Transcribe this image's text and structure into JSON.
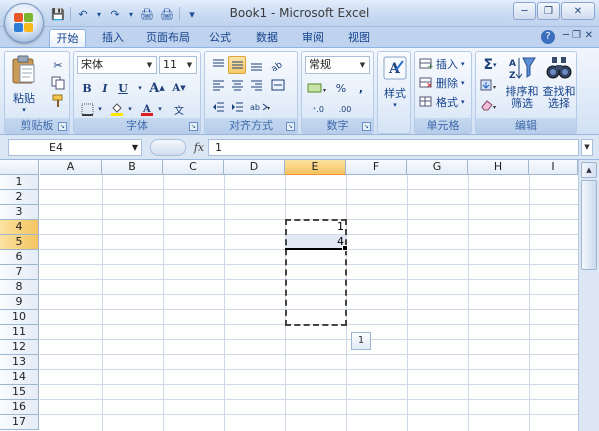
{
  "window": {
    "title": "Book1 - Microsoft Excel",
    "minimize": "─",
    "restore": "❐",
    "close": "✕"
  },
  "quick_access": {
    "save": "💾",
    "undo": "↶",
    "redo": "↷",
    "print_preview": "🖨",
    "customize": "▾"
  },
  "tabs": [
    "开始",
    "插入",
    "页面布局",
    "公式",
    "数据",
    "审阅",
    "视图"
  ],
  "active_tab": "开始",
  "ribbon": {
    "clipboard": {
      "paste_label": "粘贴",
      "group_label": "剪贴板"
    },
    "font": {
      "font_name": "宋体",
      "font_size": "11",
      "bold": "B",
      "italic": "I",
      "underline": "U",
      "grow": "A",
      "shrink": "A",
      "group_label": "字体"
    },
    "alignment": {
      "group_label": "对齐方式"
    },
    "number": {
      "format": "常规",
      "percent": "%",
      "comma": ",",
      "increase_decimal": "⁺.0",
      "decrease_decimal": ".00",
      "group_label": "数字"
    },
    "styles": {
      "label": "样式"
    },
    "cells": {
      "insert": "插入",
      "delete": "删除",
      "format": "格式",
      "group_label": "单元格"
    },
    "editing": {
      "sort_filter_line1": "排序和",
      "sort_filter_line2": "筛选",
      "find_select_line1": "查找和",
      "find_select_line2": "选择",
      "group_label": "编辑"
    }
  },
  "formula_bar": {
    "name_box": "E4",
    "fx": "fx",
    "content": "1"
  },
  "sheet": {
    "columns": [
      "A",
      "B",
      "C",
      "D",
      "E",
      "F",
      "G",
      "H",
      "I"
    ],
    "rows": [
      "1",
      "2",
      "3",
      "4",
      "5",
      "6",
      "7",
      "8",
      "9",
      "10",
      "11",
      "12",
      "13",
      "14",
      "15",
      "16",
      "17"
    ],
    "selected_column": "E",
    "selected_rows": [
      "4",
      "5"
    ],
    "cells": [
      {
        "ref": "E4",
        "value": "1"
      },
      {
        "ref": "E5",
        "value": "4"
      }
    ],
    "autofill_options": "1"
  }
}
